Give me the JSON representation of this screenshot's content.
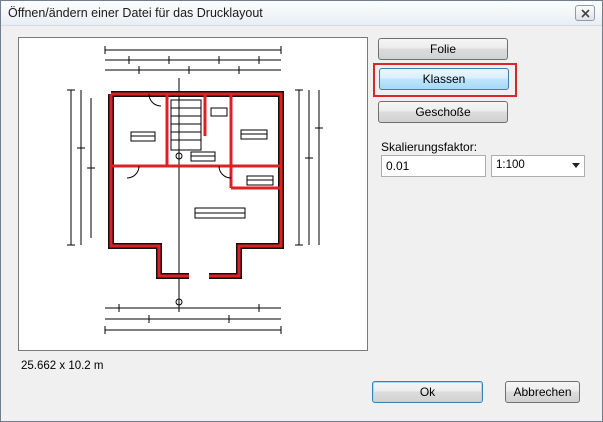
{
  "window": {
    "title": "Öffnen/ändern einer Datei für das Drucklayout"
  },
  "preview": {
    "dimensions": "25.662 x 10.2 m"
  },
  "buttons": {
    "folie": "Folie",
    "klassen": "Klassen",
    "geschosse": "Geschoße",
    "ok": "Ok",
    "abbrechen": "Abbrechen"
  },
  "scale": {
    "label": "Skalierungsfaktor:",
    "value": "0.01",
    "ratio": "1:100"
  },
  "colors": {
    "wall": "#e02020",
    "highlight": "#d9262b",
    "accent": "#3c7fb1"
  },
  "icons": {
    "close": "close-icon",
    "dropdown": "chevron-down-icon"
  }
}
